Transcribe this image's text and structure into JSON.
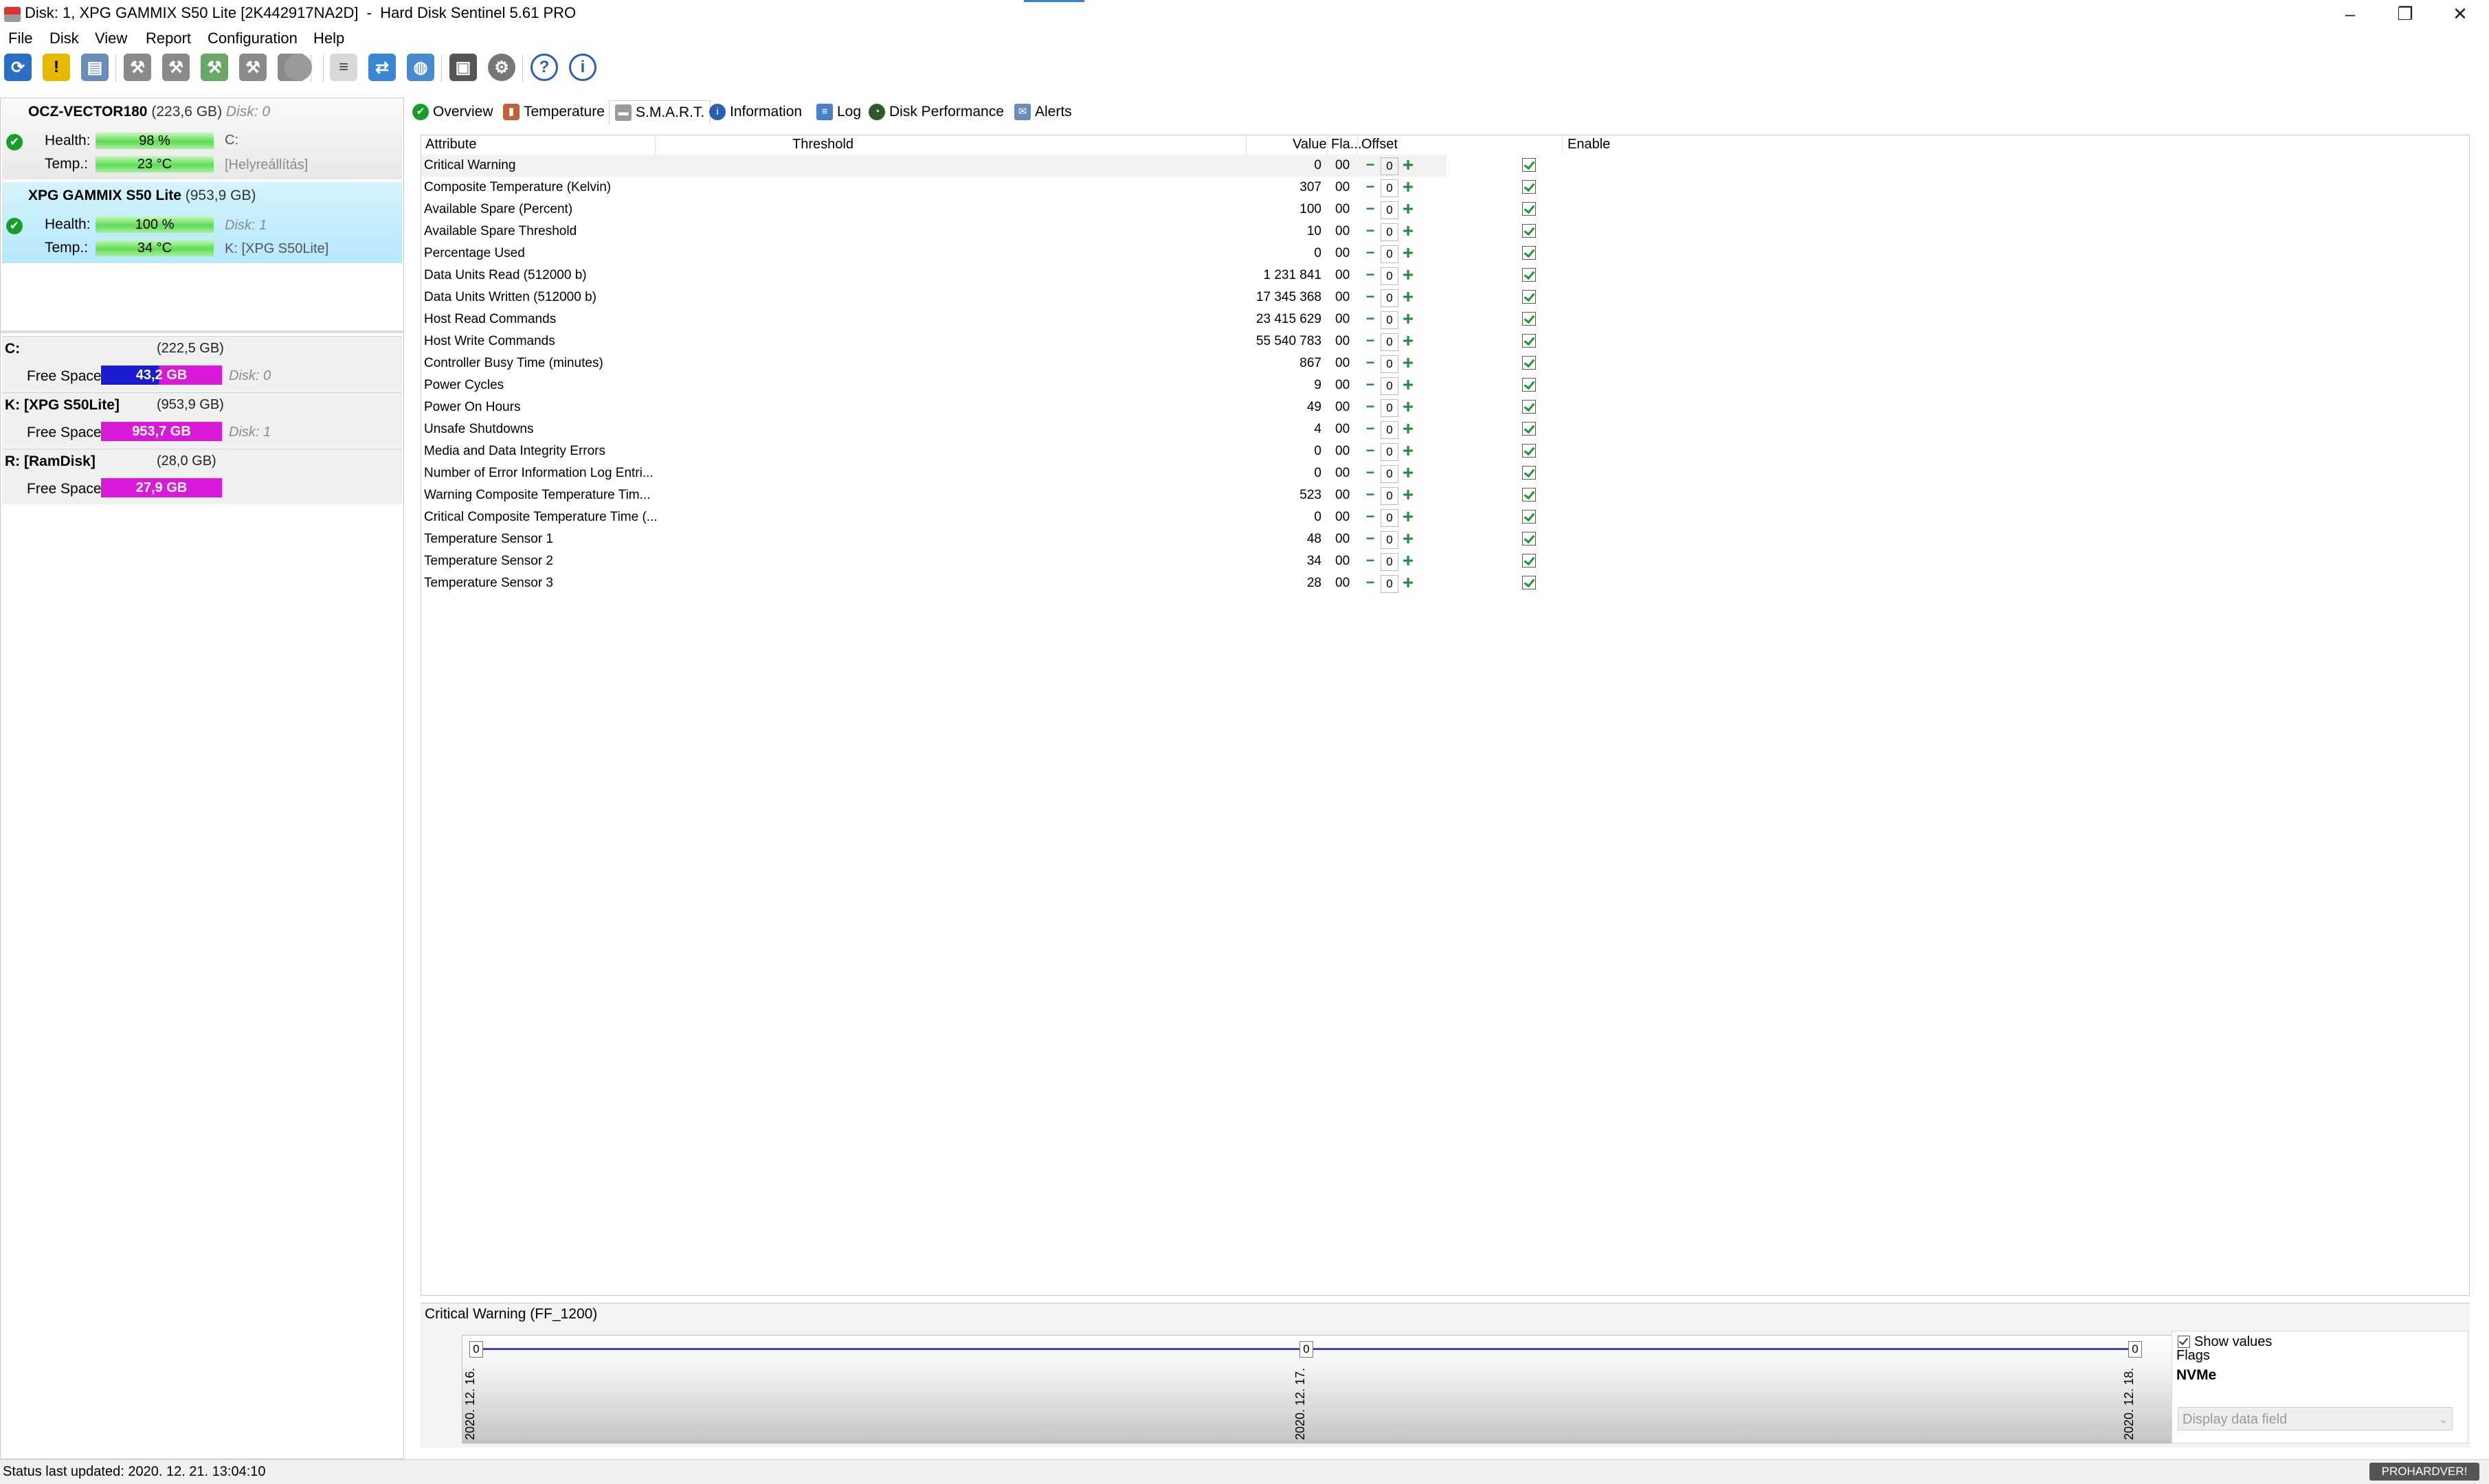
{
  "window": {
    "title": "Disk: 1, XPG GAMMIX S50 Lite [2K442917NA2D]  -  Hard Disk Sentinel 5.61 PRO",
    "minimize": "–",
    "restore": "❐",
    "close": "✕"
  },
  "menu": [
    "File",
    "Disk",
    "View",
    "Report",
    "Configuration",
    "Help"
  ],
  "toolbar_icons": [
    "refresh-icon",
    "warning-icon",
    "disk-image-icon",
    "tool-icon",
    "tool-icon",
    "tool-add-icon",
    "tool-icon",
    "tool-icon",
    "blank-icon",
    "document-icon",
    "sync-icon",
    "globe-icon",
    "monitor-icon",
    "gear-icon",
    "help-icon",
    "info-icon"
  ],
  "disks": [
    {
      "name": "OCZ-VECTOR180",
      "size": "(223,6 GB)",
      "disk_no": "Disk: 0",
      "health_label": "Health:",
      "health": "98 %",
      "health_value": 98,
      "temp_label": "Temp.:",
      "temp": "23 °C",
      "volume": "C:",
      "extra": "[Helyreállítás]"
    },
    {
      "name": "XPG GAMMIX S50 Lite",
      "size": "(953,9 GB)",
      "disk_no": "Disk: 1",
      "health_label": "Health:",
      "health": "100 %",
      "health_value": 100,
      "temp_label": "Temp.:",
      "temp": "34 °C",
      "volume": "K: [XPG S50Lite]",
      "extra": ""
    }
  ],
  "volumes": [
    {
      "name": "C:",
      "size": "(222,5 GB)",
      "free_label": "Free Space",
      "free": "43,2 GB",
      "disk": "Disk: 0",
      "bar_color": "#1b1bd0"
    },
    {
      "name": "K: [XPG S50Lite]",
      "size": "(953,9 GB)",
      "free_label": "Free Space",
      "free": "953,7 GB",
      "disk": "Disk: 1",
      "bar_color": "#d81ad8"
    },
    {
      "name": "R: [RamDisk]",
      "size": "(28,0 GB)",
      "free_label": "Free Space",
      "free": "27,9 GB",
      "disk": "",
      "bar_color": "#d81ad8"
    }
  ],
  "tabs": [
    {
      "label": "Overview",
      "icon": "check-icon"
    },
    {
      "label": "Temperature",
      "icon": "thermometer-icon"
    },
    {
      "label": "S.M.A.R.T.",
      "icon": "disk-icon"
    },
    {
      "label": "Information",
      "icon": "info-icon"
    },
    {
      "label": "Log",
      "icon": "log-icon"
    },
    {
      "label": "Disk Performance",
      "icon": "gauge-icon"
    },
    {
      "label": "Alerts",
      "icon": "alert-icon"
    }
  ],
  "smart": {
    "headers": {
      "attribute": "Attribute",
      "threshold": "Threshold",
      "value": "Value",
      "flags": "Fla...",
      "offset": "Offset",
      "enable": "Enable"
    },
    "rows": [
      {
        "attribute": "Critical Warning",
        "value": "0",
        "flags": "00",
        "offset": "0"
      },
      {
        "attribute": "Composite Temperature (Kelvin)",
        "value": "307",
        "flags": "00",
        "offset": "0"
      },
      {
        "attribute": "Available Spare (Percent)",
        "value": "100",
        "flags": "00",
        "offset": "0"
      },
      {
        "attribute": "Available Spare Threshold",
        "value": "10",
        "flags": "00",
        "offset": "0"
      },
      {
        "attribute": "Percentage Used",
        "value": "0",
        "flags": "00",
        "offset": "0"
      },
      {
        "attribute": "Data Units Read (512000 b)",
        "value": "1 231 841",
        "flags": "00",
        "offset": "0"
      },
      {
        "attribute": "Data Units Written (512000 b)",
        "value": "17 345 368",
        "flags": "00",
        "offset": "0"
      },
      {
        "attribute": "Host Read Commands",
        "value": "23 415 629",
        "flags": "00",
        "offset": "0"
      },
      {
        "attribute": "Host Write Commands",
        "value": "55 540 783",
        "flags": "00",
        "offset": "0"
      },
      {
        "attribute": "Controller Busy Time (minutes)",
        "value": "867",
        "flags": "00",
        "offset": "0"
      },
      {
        "attribute": "Power Cycles",
        "value": "9",
        "flags": "00",
        "offset": "0"
      },
      {
        "attribute": "Power On Hours",
        "value": "49",
        "flags": "00",
        "offset": "0"
      },
      {
        "attribute": "Unsafe Shutdowns",
        "value": "4",
        "flags": "00",
        "offset": "0"
      },
      {
        "attribute": "Media and Data Integrity Errors",
        "value": "0",
        "flags": "00",
        "offset": "0"
      },
      {
        "attribute": "Number of Error Information Log Entri...",
        "value": "0",
        "flags": "00",
        "offset": "0"
      },
      {
        "attribute": "Warning Composite Temperature Tim...",
        "value": "523",
        "flags": "00",
        "offset": "0"
      },
      {
        "attribute": "Critical Composite Temperature Time (...",
        "value": "0",
        "flags": "00",
        "offset": "0"
      },
      {
        "attribute": "Temperature Sensor 1",
        "value": "48",
        "flags": "00",
        "offset": "0"
      },
      {
        "attribute": "Temperature Sensor 2",
        "value": "34",
        "flags": "00",
        "offset": "0"
      },
      {
        "attribute": "Temperature Sensor 3",
        "value": "28",
        "flags": "00",
        "offset": "0"
      }
    ]
  },
  "graph": {
    "title": "Critical Warning (FF_1200)",
    "points": [
      {
        "date": "2020. 12. 16.",
        "value": "0"
      },
      {
        "date": "2020. 12. 17.",
        "value": "0"
      },
      {
        "date": "2020. 12. 18.",
        "value": "0"
      }
    ],
    "show_values": "Show values",
    "flags_label": "Flags",
    "nvme": "NVMe",
    "display_field": "Display data field"
  },
  "status": {
    "text": "Status last updated: 2020. 12. 21. 13:04:10",
    "watermark": "PROHARDVER!"
  }
}
